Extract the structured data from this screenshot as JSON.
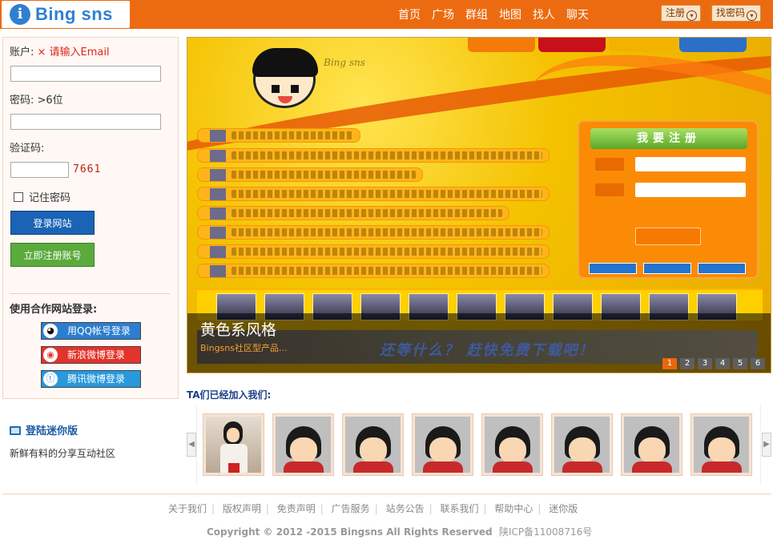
{
  "brand": {
    "logo_letter": "i",
    "name": "Bing sns"
  },
  "nav": {
    "items": [
      "首页",
      "广场",
      "群组",
      "地图",
      "找人",
      "聊天"
    ]
  },
  "header_buttons": {
    "register": "注册",
    "find_password": "找密码"
  },
  "login": {
    "account_label": "账户:",
    "account_error": "× 请输入Email",
    "account_value": "",
    "password_label": "密码: >6位",
    "password_value": "",
    "captcha_label": "验证码:",
    "captcha_value": "",
    "captcha_text": "7661",
    "remember_label": "记住密码",
    "login_button": "登录网站",
    "signup_button": "立即注册账号",
    "partner_title": "使用合作网站登录:",
    "qq_label": "用QQ帐号登录",
    "weibo_label": "新浪微博登录",
    "tweibo_label": "腾讯微博登录"
  },
  "mini": {
    "link": "登陆迷你版",
    "slogan": "新鲜有料的分享互动社区"
  },
  "banner": {
    "title": "黄色系风格",
    "subtitle": "Bingsns社区型产品...",
    "tagline": "还等什么？ 赶快免费下载吧！",
    "pages": [
      "1",
      "2",
      "3",
      "4",
      "5",
      "6"
    ],
    "active_page": 1
  },
  "joined": {
    "title": "TA们已经加入我们:",
    "count_shown": 8
  },
  "footer": {
    "links": [
      "关于我们",
      "版权声明",
      "免责声明",
      "广告服务",
      "站务公告",
      "联系我们",
      "帮助中心",
      "迷你版"
    ],
    "copyright": "Copyright © 2012 -2015 Bingsns All Rights Reserved",
    "icp": "陕ICP备11008716号"
  },
  "colors": {
    "header": "#ec6b10",
    "login_button": "#1a63b5",
    "signup_button": "#5aaa3c",
    "accent_link": "#1a5aa5"
  }
}
